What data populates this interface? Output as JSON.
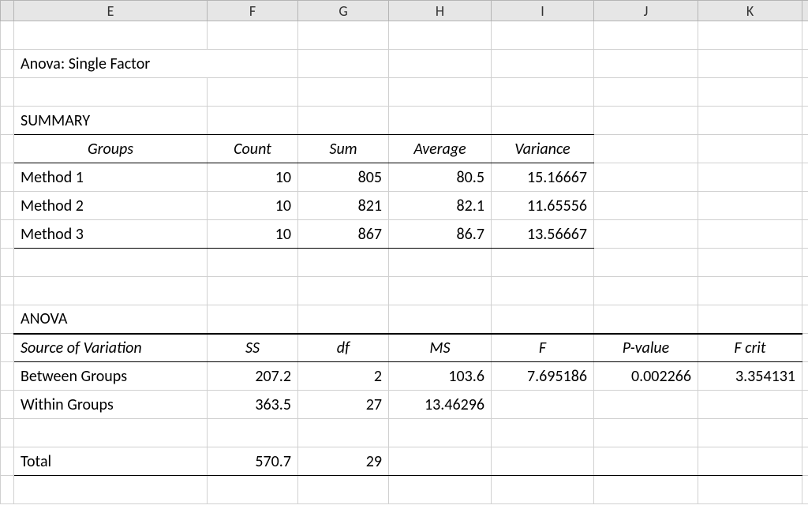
{
  "columns": {
    "E": "E",
    "F": "F",
    "G": "G",
    "H": "H",
    "I": "I",
    "J": "J",
    "K": "K"
  },
  "title": "Anova: Single Factor",
  "summary": {
    "heading": "SUMMARY",
    "headers": {
      "groups": "Groups",
      "count": "Count",
      "sum": "Sum",
      "average": "Average",
      "variance": "Variance"
    },
    "rows": [
      {
        "group": "Method 1",
        "count": "10",
        "sum": "805",
        "avg": "80.5",
        "var": "15.16667"
      },
      {
        "group": "Method 2",
        "count": "10",
        "sum": "821",
        "avg": "82.1",
        "var": "11.65556"
      },
      {
        "group": "Method 3",
        "count": "10",
        "sum": "867",
        "avg": "86.7",
        "var": "13.56667"
      }
    ]
  },
  "anova": {
    "heading": "ANOVA",
    "headers": {
      "src": "Source of Variation",
      "ss": "SS",
      "df": "df",
      "ms": "MS",
      "f": "F",
      "p": "P-value",
      "fcrit": "F crit"
    },
    "rows": {
      "between": {
        "src": "Between Groups",
        "ss": "207.2",
        "df": "2",
        "ms": "103.6",
        "f": "7.695186",
        "p": "0.002266",
        "fcrit": "3.354131"
      },
      "within": {
        "src": "Within Groups",
        "ss": "363.5",
        "df": "27",
        "ms": "13.46296",
        "f": "",
        "p": "",
        "fcrit": ""
      },
      "total": {
        "src": "Total",
        "ss": "570.7",
        "df": "29",
        "ms": "",
        "f": "",
        "p": "",
        "fcrit": ""
      }
    }
  },
  "chart_data": {
    "type": "table",
    "title": "Anova: Single Factor",
    "summary": {
      "columns": [
        "Groups",
        "Count",
        "Sum",
        "Average",
        "Variance"
      ],
      "data": [
        [
          "Method 1",
          10,
          805,
          80.5,
          15.16667
        ],
        [
          "Method 2",
          10,
          821,
          82.1,
          11.65556
        ],
        [
          "Method 3",
          10,
          867,
          86.7,
          13.56667
        ]
      ]
    },
    "anova": {
      "columns": [
        "Source of Variation",
        "SS",
        "df",
        "MS",
        "F",
        "P-value",
        "F crit"
      ],
      "data": [
        [
          "Between Groups",
          207.2,
          2,
          103.6,
          7.695186,
          0.002266,
          3.354131
        ],
        [
          "Within Groups",
          363.5,
          27,
          13.46296,
          null,
          null,
          null
        ],
        [
          "Total",
          570.7,
          29,
          null,
          null,
          null,
          null
        ]
      ]
    }
  }
}
